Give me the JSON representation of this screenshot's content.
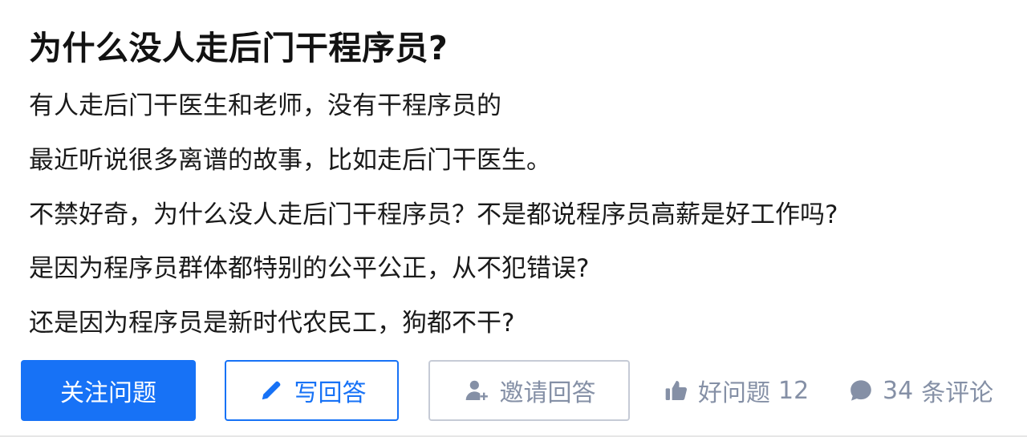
{
  "question": {
    "title": "为什么没人走后门干程序员?",
    "lines": [
      "有人走后门干医生和老师，没有干程序员的",
      "最近听说很多离谱的故事，比如走后门干医生。",
      "不禁好奇，为什么没人走后门干程序员？不是都说程序员高薪是好工作吗?",
      "是因为程序员群体都特别的公平公正，从不犯错误?",
      "还是因为程序员是新时代农民工，狗都不干?"
    ]
  },
  "actions": {
    "follow_label": "关注问题",
    "answer_label": "写回答",
    "invite_label": "邀请回答",
    "good_label": "好问题",
    "good_count": "12",
    "comment_count": "34",
    "comment_unit": "条评论"
  },
  "icons": {
    "answer": "pencil-icon",
    "invite": "add-user-icon",
    "good": "thumbs-up-icon",
    "comment": "comment-bubble-icon"
  },
  "colors": {
    "primary": "#1772f6",
    "muted": "#8590a6",
    "text": "#121212"
  }
}
